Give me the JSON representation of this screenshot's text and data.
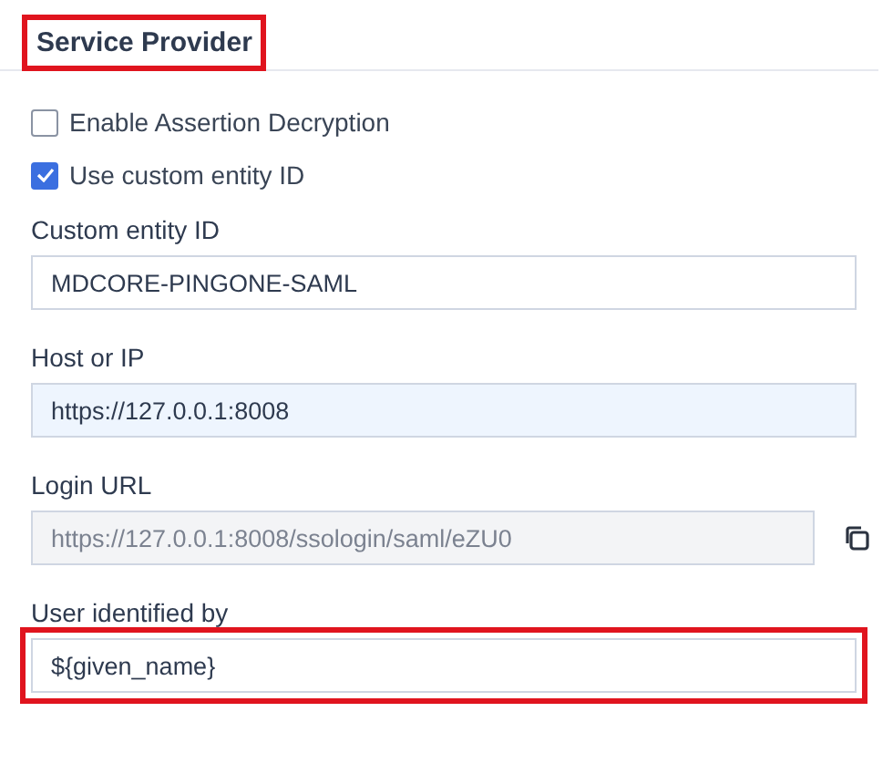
{
  "section": {
    "title": "Service Provider",
    "highlighted": true
  },
  "checkboxes": [
    {
      "label": "Enable Assertion Decryption",
      "checked": false
    },
    {
      "label": "Use custom entity ID",
      "checked": true
    }
  ],
  "fields": [
    {
      "label": "Custom entity ID",
      "value": "MDCORE-PINGONE-SAML",
      "disabled": false,
      "autofilled": false,
      "copyable": false,
      "highlighted": false
    },
    {
      "label": "Host or IP",
      "value": "https://127.0.0.1:8008",
      "disabled": false,
      "autofilled": true,
      "copyable": false,
      "highlighted": false
    },
    {
      "label": "Login URL",
      "value": "https://127.0.0.1:8008/ssologin/saml/eZU0",
      "disabled": true,
      "autofilled": false,
      "copyable": true,
      "highlighted": false
    },
    {
      "label": "User identified by",
      "value": "${given_name}",
      "disabled": false,
      "autofilled": false,
      "copyable": false,
      "highlighted": true
    }
  ]
}
